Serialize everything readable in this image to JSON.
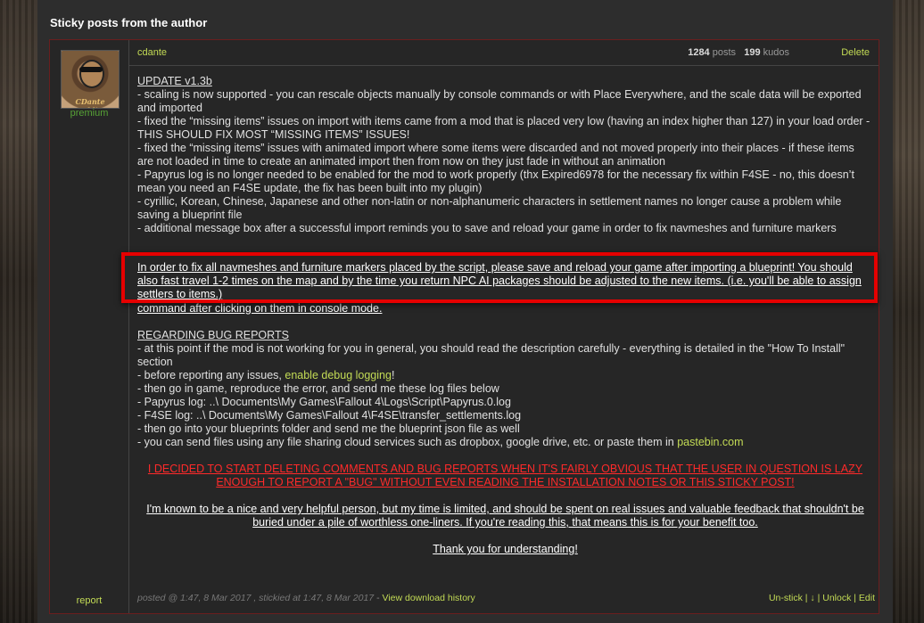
{
  "section_title": "Sticky posts from the author",
  "post": {
    "author": "cdante",
    "rank": "premium",
    "avatar_text": "CDante Modding",
    "posts_count": "1284",
    "posts_label": "posts",
    "kudos_count": "199",
    "kudos_label": "kudos",
    "delete_label": "Delete",
    "report_label": "report",
    "update_heading": "UPDATE v1.3b",
    "update_items": [
      "- scaling is now supported - you can rescale objects manually by console commands or with Place Everywhere, and the scale data will be exported and imported",
      "- fixed the “missing items” issues on import with items came from a mod that is placed very low (having an index higher than 127) in your load order - THIS SHOULD FIX MOST “MISSING ITEMS” ISSUES!",
      "- fixed the “missing items” issues with animated import where some items were discarded and not moved properly into their places - if these items are not loaded in time to create an animated import then from now on they just fade in without an animation",
      "- Papyrus log is no longer needed to be enabled for the mod to work properly (thx Expired6978 for the necessary fix within F4SE - no, this doesn’t mean you need an F4SE update, the fix has been built into my plugin)",
      "- cyrillic, Korean, Chinese, Japanese and other non-latin or non-alphanumeric characters in settlement names no longer cause a problem while saving a blueprint file",
      "- additional message box after a successful import reminds you to save and reload your game in order to fix navmeshes and furniture markers"
    ],
    "highlight_text": "In order to fix all navmeshes and furniture markers placed by the script, please save and reload your game after importing a blueprint! You should also fast travel 1-2 times on the map and by the time you return NPC AI packages should be adjusted to the new items. (i.e. you'll be able to assign settlers to items.)",
    "hidden_note": "If you experience imported animals or creatures gathering around the workshop (i.e. the actual workshop object) just use the resetai console command after clicking on them in console mode.",
    "bug_heading": "REGARDING BUG REPORTS",
    "bug_items_1": [
      "- at this point if the mod is not working for you in general, you should read the description carefully - everything is detailed in the \"How To Install\" section"
    ],
    "bug_debug_prefix": "- before reporting any issues, ",
    "bug_debug_link": "enable debug logging",
    "bug_debug_suffix": "!",
    "bug_items_2": [
      "- then go in game, reproduce the error, and send me these log files below",
      "- Papyrus log: ..\\ Documents\\My Games\\Fallout 4\\Logs\\Script\\Papyrus.0.log",
      "- F4SE log: ..\\ Documents\\My Games\\Fallout 4\\F4SE\\transfer_settlements.log",
      "- then go into your blueprints folder and send me the blueprint json file as well"
    ],
    "bug_files_prefix": "- you can send files using any file sharing cloud services such as dropbox, google drive, etc. or paste them in ",
    "bug_files_link": "pastebin.com",
    "warning_red": "I DECIDED TO START DELETING COMMENTS AND BUG REPORTS WHEN IT'S FAIRLY OBVIOUS THAT THE USER IN QUESTION IS LAZY ENOUGH TO REPORT A \"BUG\" WITHOUT EVEN READING THE INSTALLATION NOTES OR THIS STICKY POST!",
    "nice_person": "I'm known to be a nice and very helpful person, but my time is limited, and should be spent on real issues and valuable feedback that shouldn't be buried under a pile of worthless one-liners. If you're reading this, that means this is for your benefit too.",
    "thanks": "Thank you for understanding!",
    "posted_text": "posted @ 1:47, 8 Mar 2017 , stickied at 1:47, 8 Mar 2017",
    "history_sep": " - ",
    "history_link": "View download history",
    "unstick_label": "Un-stick",
    "down_label": "↓",
    "unlock_label": "Unlock",
    "edit_label": "Edit",
    "sep": " | "
  }
}
